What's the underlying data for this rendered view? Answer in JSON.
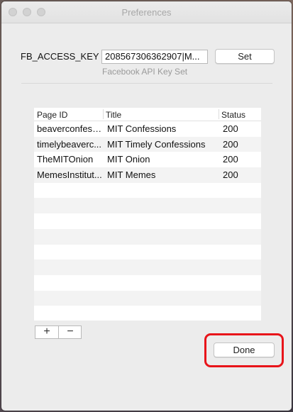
{
  "window": {
    "title": "Preferences"
  },
  "access_key": {
    "label": "FB_ACCESS_KEY :",
    "value": "208567306362907|M...",
    "set_label": "Set",
    "status": "Facebook API Key Set"
  },
  "table": {
    "columns": [
      "Page ID",
      "Title",
      "Status"
    ],
    "rows": [
      [
        "beaverconfess...",
        "MIT Confessions",
        "200"
      ],
      [
        "timelybeaverc...",
        "MIT Timely Confessions",
        "200"
      ],
      [
        "TheMITOnion",
        "MIT Onion",
        "200"
      ],
      [
        "MemesInstitut...",
        "MIT Memes",
        "200"
      ],
      [
        "",
        "",
        ""
      ],
      [
        "",
        "",
        ""
      ],
      [
        "",
        "",
        ""
      ],
      [
        "",
        "",
        ""
      ],
      [
        "",
        "",
        ""
      ],
      [
        "",
        "",
        ""
      ],
      [
        "",
        "",
        ""
      ],
      [
        "",
        "",
        ""
      ],
      [
        "",
        "",
        ""
      ]
    ]
  },
  "controls": {
    "add_label": "+",
    "remove_label": "−",
    "done_label": "Done"
  },
  "colors": {
    "highlight": "#e8141a"
  },
  "icons": {
    "close": "close-icon",
    "minimize": "minimize-icon",
    "zoom": "zoom-icon"
  }
}
